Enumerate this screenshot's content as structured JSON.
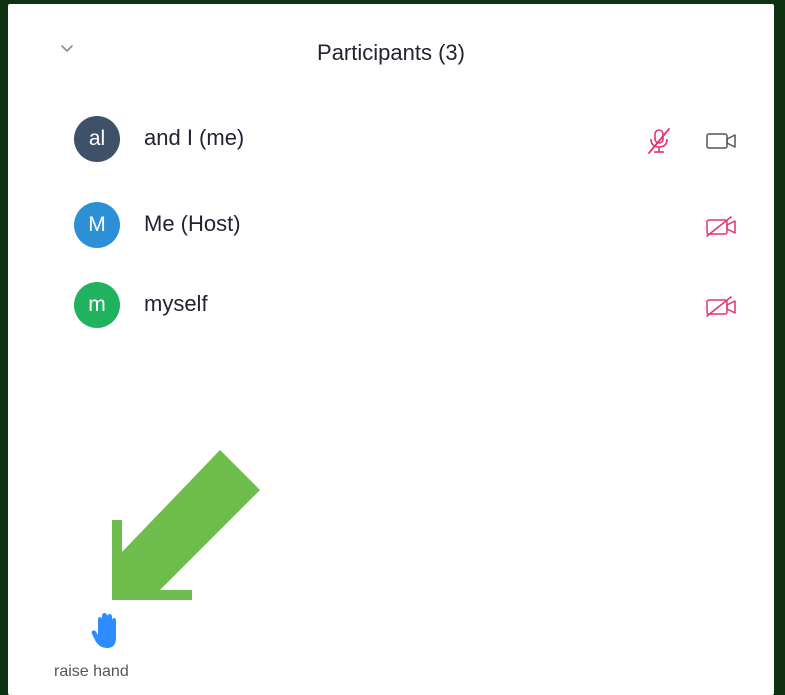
{
  "header": {
    "title": "Participants (3)"
  },
  "participants": [
    {
      "initials": "al",
      "name": "and I (me)",
      "avatar_color": "#3f5169",
      "audio": "muted",
      "video": "on"
    },
    {
      "initials": "M",
      "name": "Me (Host)",
      "avatar_color": "#2d8fd5",
      "audio": "none",
      "video": "off"
    },
    {
      "initials": "m",
      "name": "myself",
      "avatar_color": "#20b25e",
      "audio": "none",
      "video": "off"
    }
  ],
  "footer": {
    "raise_hand_label": "raise hand"
  },
  "colors": {
    "background": "#0f3312",
    "panel": "#ffffff",
    "muted_red": "#e8336b",
    "hand_blue": "#2d8cff",
    "arrow_green": "#6fbd4c"
  }
}
